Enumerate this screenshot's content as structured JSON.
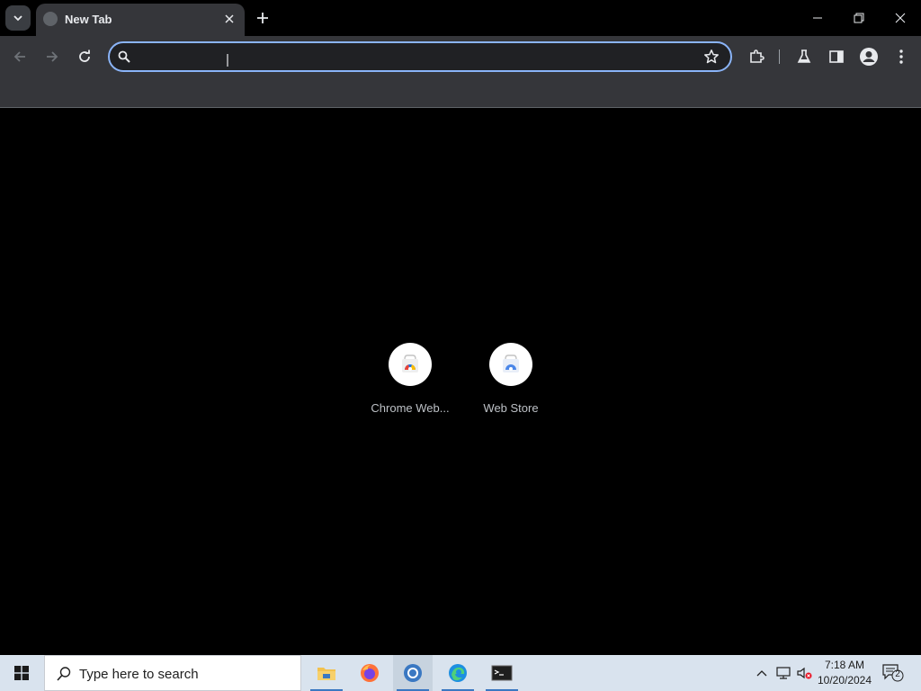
{
  "browser": {
    "tab": {
      "title": "New Tab"
    },
    "omnibox": {
      "value": "",
      "placeholder": ""
    },
    "shortcuts": [
      {
        "label": "Chrome Web..."
      },
      {
        "label": "Web Store"
      }
    ]
  },
  "taskbar": {
    "search_placeholder": "Type here to search",
    "clock": {
      "time": "7:18 AM",
      "date": "10/20/2024"
    },
    "notifications_count": "2",
    "apps": [
      "file-explorer",
      "firefox",
      "chrome",
      "edge",
      "terminal"
    ]
  },
  "colors": {
    "omnibox_border": "#8ab4f8",
    "toolbar_bg": "#35363a",
    "taskbar_bg": "#d9e3ee"
  }
}
